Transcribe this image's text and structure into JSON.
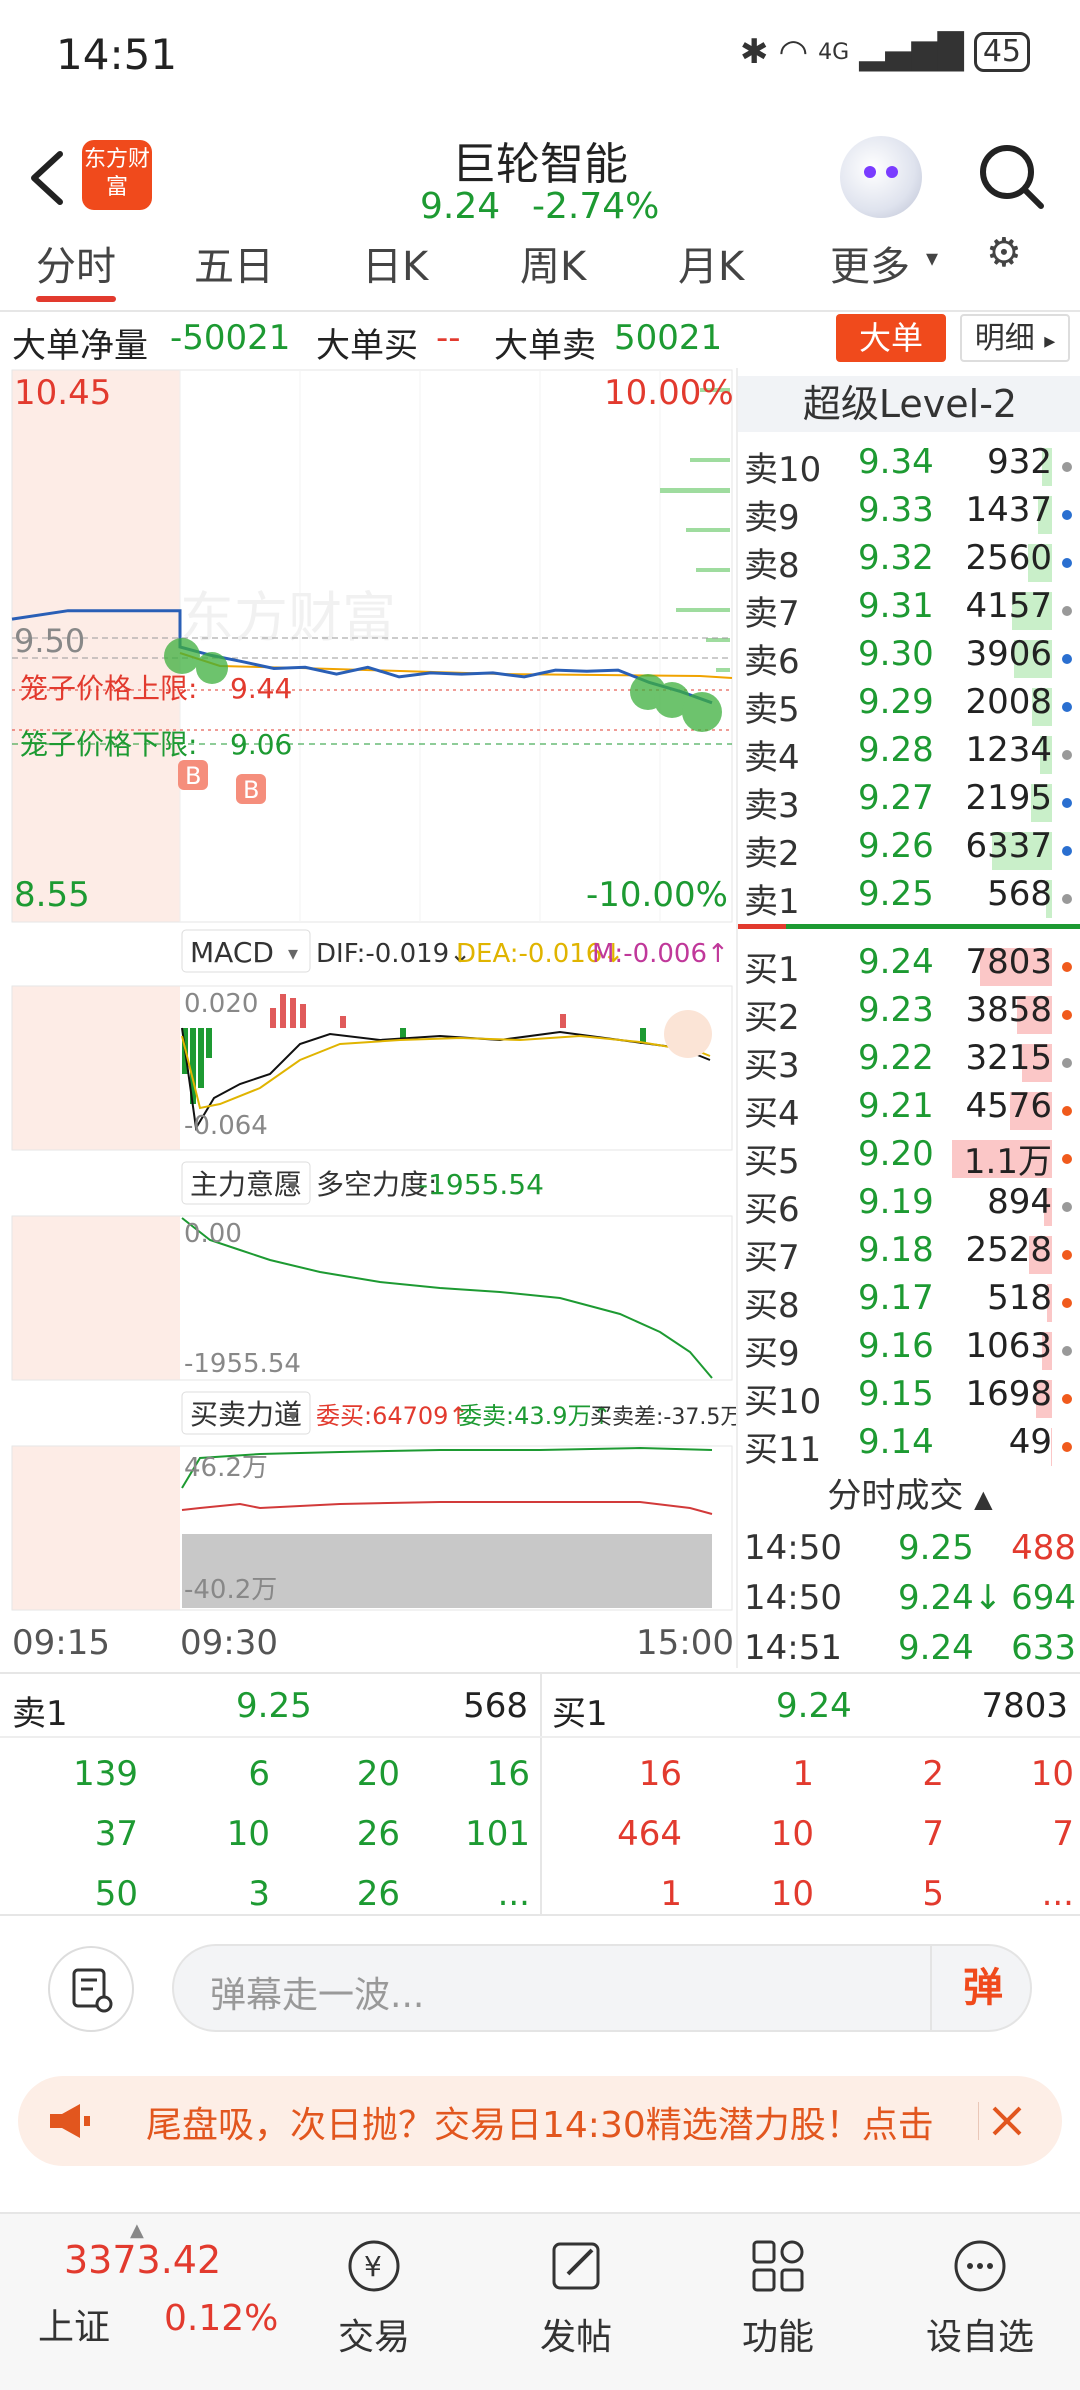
{
  "status": {
    "time": "14:51",
    "network": "4G",
    "battery": "45"
  },
  "header": {
    "logo_text": "东方财富",
    "stock_name": "巨轮智能",
    "price": "9.24",
    "change_pct": "-2.74%"
  },
  "tabs": [
    "分时",
    "五日",
    "日K",
    "周K",
    "月K",
    "更多"
  ],
  "big_order": {
    "net_label": "大单净量",
    "net_value": "-50021",
    "buy_label": "大单买",
    "buy_value": "--",
    "sell_label": "大单卖",
    "sell_value": "50021",
    "btn_big": "大单",
    "btn_detail": "明细"
  },
  "chart": {
    "price_high": "10.45",
    "price_low": "8.55",
    "pct_high": "10.00%",
    "pct_low": "-10.00%",
    "mid_price": "9.50",
    "cage_upper_label": "笼子价格上限:",
    "cage_upper_value": "9.44",
    "cage_lower_label": "笼子价格下限:",
    "cage_lower_value": "9.06",
    "marker_b": "B",
    "watermark": "东方财富",
    "macd": {
      "name": "MACD",
      "dif": "DIF:-0.019↓",
      "dea": "DEA:-0.016↓",
      "m": "M:-0.006↑",
      "top": "0.020",
      "bottom": "-0.064"
    },
    "intent": {
      "name": "主力意愿",
      "label": "多空力度:",
      "value": "-1955.54",
      "top": "0.00",
      "bottom": "-1955.54"
    },
    "force": {
      "name": "买卖力道",
      "buy": "委买:64709↑",
      "sell": "委卖:43.9万↑",
      "diff": "买卖差:-37.5万↑",
      "top": "46.2万",
      "bottom": "-40.2万"
    },
    "time_start": "09:15",
    "time_open": "09:30",
    "time_end": "15:00"
  },
  "chart_data": {
    "type": "line",
    "title": "",
    "ylim": [
      8.55,
      10.45
    ],
    "series": [
      {
        "values": [
          9.6,
          9.63,
          9.63,
          9.63,
          9.5,
          9.47,
          9.44,
          9.43,
          9.42,
          9.41,
          9.42,
          9.4,
          9.4,
          9.41,
          9.4,
          9.4,
          9.41,
          9.42,
          9.41,
          9.38,
          9.34,
          9.3
        ]
      }
    ]
  },
  "orderbook": {
    "title": "超级Level-2",
    "asks": [
      {
        "label": "卖10",
        "price": "9.34",
        "vol": "932",
        "bar": 0.1
      },
      {
        "label": "卖9",
        "price": "9.33",
        "vol": "1437",
        "bar": 0.14
      },
      {
        "label": "卖8",
        "price": "9.32",
        "vol": "2560",
        "bar": 0.24
      },
      {
        "label": "卖7",
        "price": "9.31",
        "vol": "4157",
        "bar": 0.4
      },
      {
        "label": "卖6",
        "price": "9.30",
        "vol": "3906",
        "bar": 0.38
      },
      {
        "label": "卖5",
        "price": "9.29",
        "vol": "2008",
        "bar": 0.2
      },
      {
        "label": "卖4",
        "price": "9.28",
        "vol": "1234",
        "bar": 0.12
      },
      {
        "label": "卖3",
        "price": "9.27",
        "vol": "2195",
        "bar": 0.21
      },
      {
        "label": "卖2",
        "price": "9.26",
        "vol": "6337",
        "bar": 0.6
      },
      {
        "label": "卖1",
        "price": "9.25",
        "vol": "568",
        "bar": 0.06
      }
    ],
    "bids": [
      {
        "label": "买1",
        "price": "9.24",
        "vol": "7803",
        "bar": 0.72
      },
      {
        "label": "买2",
        "price": "9.23",
        "vol": "3858",
        "bar": 0.35
      },
      {
        "label": "买3",
        "price": "9.22",
        "vol": "3215",
        "bar": 0.3
      },
      {
        "label": "买4",
        "price": "9.21",
        "vol": "4576",
        "bar": 0.42
      },
      {
        "label": "买5",
        "price": "9.20",
        "vol": "1.1万",
        "bar": 1.0
      },
      {
        "label": "买6",
        "price": "9.19",
        "vol": "894",
        "bar": 0.08
      },
      {
        "label": "买7",
        "price": "9.18",
        "vol": "2528",
        "bar": 0.23
      },
      {
        "label": "买8",
        "price": "9.17",
        "vol": "518",
        "bar": 0.05
      },
      {
        "label": "买9",
        "price": "9.16",
        "vol": "1063",
        "bar": 0.1
      },
      {
        "label": "买10",
        "price": "9.15",
        "vol": "1698",
        "bar": 0.16
      },
      {
        "label": "买11",
        "price": "9.14",
        "vol": "49",
        "bar": 0.01
      }
    ],
    "trades_title": "分时成交",
    "trades": [
      {
        "time": "14:50",
        "price": "9.25",
        "vol": "488"
      },
      {
        "time": "14:50",
        "price": "9.24↓",
        "vol": "694"
      },
      {
        "time": "14:51",
        "price": "9.24",
        "vol": "633"
      }
    ]
  },
  "queue": {
    "sell_label": "卖1",
    "sell_price": "9.25",
    "sell_vol": "568",
    "buy_label": "买1",
    "buy_price": "9.24",
    "buy_vol": "7803",
    "sell_rows": [
      [
        "139",
        "6",
        "20",
        "16"
      ],
      [
        "37",
        "10",
        "26",
        "101"
      ],
      [
        "50",
        "3",
        "26",
        "..."
      ]
    ],
    "buy_rows": [
      [
        "16",
        "1",
        "2",
        "10"
      ],
      [
        "464",
        "10",
        "7",
        "7"
      ],
      [
        "1",
        "10",
        "5",
        "..."
      ]
    ]
  },
  "comment": {
    "placeholder": "弹幕走一波...",
    "danmu": "弹"
  },
  "promo": {
    "text": "尾盘吸，次日抛？交易日14:30精选潜力股！点击"
  },
  "bottom_nav": {
    "index_value": "3373.42",
    "index_name": "上证",
    "index_change": "0.12%",
    "items": [
      "交易",
      "发帖",
      "功能",
      "设自选"
    ]
  }
}
